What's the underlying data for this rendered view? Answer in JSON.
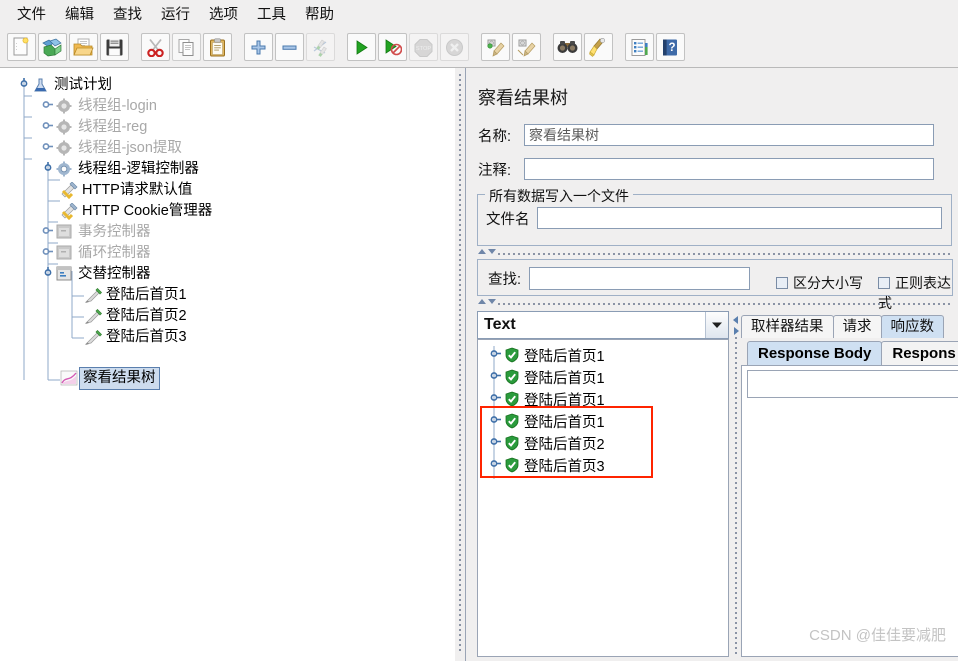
{
  "menubar": {
    "items": [
      {
        "label": "文件",
        "name": "menu-file"
      },
      {
        "label": "编辑",
        "name": "menu-edit"
      },
      {
        "label": "查找",
        "name": "menu-search"
      },
      {
        "label": "运行",
        "name": "menu-run"
      },
      {
        "label": "选项",
        "name": "menu-options"
      },
      {
        "label": "工具",
        "name": "menu-tools"
      },
      {
        "label": "帮助",
        "name": "menu-help"
      }
    ]
  },
  "toolbar": {
    "buttons": [
      {
        "icon": "new-document-icon",
        "enabled": true
      },
      {
        "icon": "templates-icon",
        "enabled": true
      },
      {
        "icon": "open-folder-icon",
        "enabled": true
      },
      {
        "icon": "save-icon",
        "enabled": true
      },
      {
        "icon": "cut-icon",
        "enabled": true
      },
      {
        "icon": "copy-icon",
        "enabled": true
      },
      {
        "icon": "paste-icon",
        "enabled": true
      },
      {
        "icon": "expand-all-icon",
        "enabled": true
      },
      {
        "icon": "collapse-all-icon",
        "enabled": true
      },
      {
        "icon": "toggle-icon",
        "enabled": false
      },
      {
        "icon": "start-icon",
        "enabled": true
      },
      {
        "icon": "start-no-pause-icon",
        "enabled": true
      },
      {
        "icon": "stop-icon",
        "enabled": false
      },
      {
        "icon": "shutdown-icon",
        "enabled": false
      },
      {
        "icon": "clear-icon",
        "enabled": true
      },
      {
        "icon": "clear-all-icon",
        "enabled": true
      },
      {
        "icon": "search-binoculars-icon",
        "enabled": true
      },
      {
        "icon": "search-reset-broom-icon",
        "enabled": true
      },
      {
        "icon": "function-helper-icon",
        "enabled": true
      },
      {
        "icon": "help-book-icon",
        "enabled": true
      }
    ]
  },
  "tree": {
    "nodes": [
      {
        "label": "测试计划",
        "icon": "test-plan-icon",
        "depth": 0,
        "dim": false,
        "selected": false,
        "expanded": true
      },
      {
        "label": "线程组-login",
        "icon": "thread-group-icon",
        "depth": 1,
        "dim": true,
        "selected": false,
        "expanded": false
      },
      {
        "label": "线程组-reg",
        "icon": "thread-group-icon",
        "depth": 1,
        "dim": true,
        "selected": false,
        "expanded": false
      },
      {
        "label": "线程组-json提取",
        "icon": "thread-group-icon",
        "depth": 1,
        "dim": true,
        "selected": false,
        "expanded": false
      },
      {
        "label": "线程组-逻辑控制器",
        "icon": "thread-group-active-icon",
        "depth": 1,
        "dim": false,
        "selected": false,
        "expanded": true
      },
      {
        "label": "HTTP请求默认值",
        "icon": "config-element-icon",
        "depth": 2,
        "dim": false,
        "selected": false,
        "expanded": false
      },
      {
        "label": "HTTP Cookie管理器",
        "icon": "config-element-icon",
        "depth": 2,
        "dim": false,
        "selected": false,
        "expanded": false
      },
      {
        "label": "事务控制器",
        "icon": "controller-icon",
        "depth": 2,
        "dim": true,
        "selected": false,
        "expanded": false
      },
      {
        "label": "循环控制器",
        "icon": "controller-icon",
        "depth": 2,
        "dim": true,
        "selected": false,
        "expanded": false
      },
      {
        "label": "交替控制器",
        "icon": "controller-active-icon",
        "depth": 2,
        "dim": false,
        "selected": false,
        "expanded": true
      },
      {
        "label": "登陆后首页1",
        "icon": "http-sampler-icon",
        "depth": 3,
        "dim": false,
        "selected": false,
        "expanded": false
      },
      {
        "label": "登陆后首页2",
        "icon": "http-sampler-icon",
        "depth": 3,
        "dim": false,
        "selected": false,
        "expanded": false
      },
      {
        "label": "登陆后首页3",
        "icon": "http-sampler-icon",
        "depth": 3,
        "dim": false,
        "selected": false,
        "expanded": false
      },
      {
        "label": "察看结果树",
        "icon": "view-results-tree-icon",
        "depth": 2,
        "dim": false,
        "selected": true,
        "expanded": false
      }
    ]
  },
  "panel": {
    "title": "察看结果树",
    "name_label": "名称:",
    "name_value": "察看结果树",
    "comment_label": "注释:",
    "comment_value": "",
    "filegroup_title": "所有数据写入一个文件",
    "filename_label": "文件名",
    "filename_value": "",
    "search_label": "查找:",
    "search_value": "",
    "search_placeholder": "",
    "case_sensitive_label": "区分大小写",
    "case_sensitive_checked": false,
    "regex_label": "正则表达式",
    "regex_checked": false,
    "renderer_selected": "Text"
  },
  "results": {
    "items": [
      {
        "label": "登陆后首页1",
        "status": "success",
        "highlighted": false
      },
      {
        "label": "登陆后首页1",
        "status": "success",
        "highlighted": false
      },
      {
        "label": "登陆后首页1",
        "status": "success",
        "highlighted": false
      },
      {
        "label": "登陆后首页1",
        "status": "success",
        "highlighted": true
      },
      {
        "label": "登陆后首页2",
        "status": "success",
        "highlighted": true
      },
      {
        "label": "登陆后首页3",
        "status": "success",
        "highlighted": true
      }
    ],
    "highlight_color": "#ff2400"
  },
  "tabs": {
    "primary": [
      {
        "label": "取样器结果",
        "selected": false
      },
      {
        "label": "请求",
        "selected": false
      },
      {
        "label": "响应数",
        "selected": true
      }
    ],
    "secondary": [
      {
        "label": "Response Body",
        "selected": true
      },
      {
        "label": "Respons",
        "selected": false
      }
    ]
  },
  "watermark": {
    "text": "CSDN @佳佳要减肥"
  }
}
